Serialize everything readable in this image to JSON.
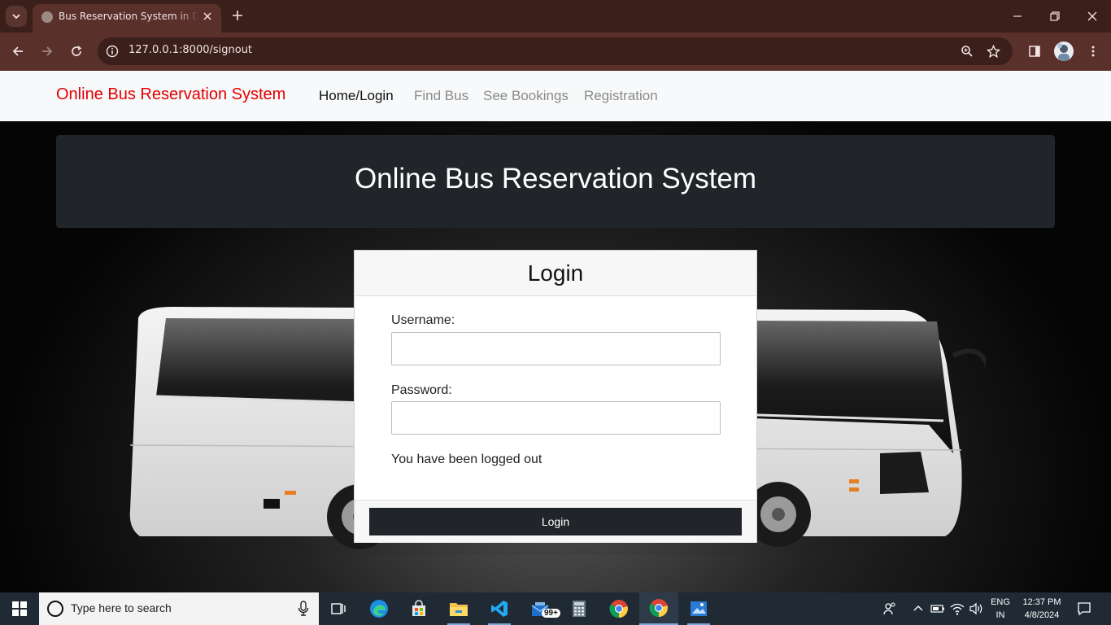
{
  "browser": {
    "tab_title": "Bus Reservation System in Django",
    "url": "127.0.0.1:8000/signout"
  },
  "navbar": {
    "brand": "Online Bus Reservation System",
    "links": [
      "Home/Login",
      "Find Bus",
      "See Bookings",
      "Registration"
    ],
    "active_index": 0
  },
  "jumbotron": {
    "title": "Online Bus Reservation System"
  },
  "login_card": {
    "title": "Login",
    "username_label": "Username:",
    "username_value": "",
    "password_label": "Password:",
    "password_value": "",
    "message": "You have been logged out",
    "button_label": "Login"
  },
  "taskbar": {
    "search_placeholder": "Type here to search",
    "apps": [
      "task-view-icon",
      "edge-icon",
      "store-icon",
      "file-explorer-icon",
      "vscode-icon",
      "mail-icon",
      "calculator-icon",
      "chrome-icon",
      "chrome-icon",
      "photos-icon"
    ],
    "mail_badge": "99+",
    "language": "ENG",
    "region": "IN",
    "time": "12:37 PM",
    "date": "4/8/2024"
  },
  "colors": {
    "chrome_dark": "#3b1f1b",
    "chrome_toolbar": "#5a302b",
    "brand_red": "#e10000",
    "dark_panel": "#212529",
    "taskbar": "#1f2a35"
  }
}
